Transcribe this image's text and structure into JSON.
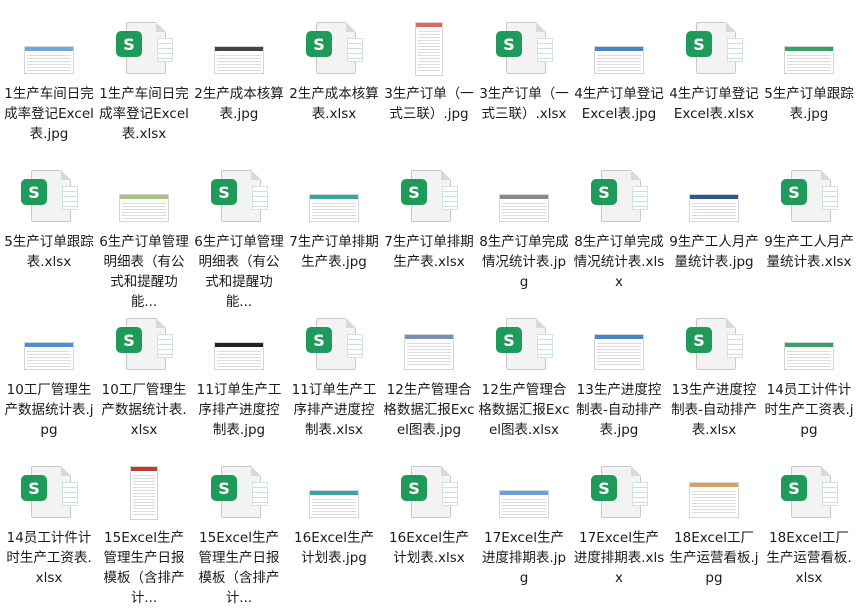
{
  "files": [
    {
      "name": "1生产车间日完成率登记Excel表.jpg",
      "kind": "jpg",
      "accent": "#6fa8dc",
      "shape": "wide"
    },
    {
      "name": "1生产车间日完成率登记Excel表.xlsx",
      "kind": "xlsx"
    },
    {
      "name": "2生产成本核算表.jpg",
      "kind": "jpg",
      "accent": "#444444",
      "shape": "wide"
    },
    {
      "name": "2生产成本核算表.xlsx",
      "kind": "xlsx"
    },
    {
      "name": "3生产订单（一式三联）.jpg",
      "kind": "jpg",
      "accent": "#e06666",
      "shape": "tall"
    },
    {
      "name": "3生产订单（一式三联）.xlsx",
      "kind": "xlsx"
    },
    {
      "name": "4生产订单登记Excel表.jpg",
      "kind": "jpg",
      "accent": "#4a86c5",
      "shape": "wide"
    },
    {
      "name": "4生产订单登记Excel表.xlsx",
      "kind": "xlsx"
    },
    {
      "name": "5生产订单跟踪表.jpg",
      "kind": "jpg",
      "accent": "#38a169",
      "shape": "wide"
    },
    {
      "name": "5生产订单跟踪表.xlsx",
      "kind": "xlsx"
    },
    {
      "name": "6生产订单管理明细表（有公式和提醒功能...",
      "kind": "jpg",
      "accent": "#a9c47f",
      "shape": "wide"
    },
    {
      "name": "6生产订单管理明细表（有公式和提醒功能...",
      "kind": "xlsx"
    },
    {
      "name": "7生产订单排期生产表.jpg",
      "kind": "jpg",
      "accent": "#3aa6a0",
      "shape": "wide"
    },
    {
      "name": "7生产订单排期生产表.xlsx",
      "kind": "xlsx"
    },
    {
      "name": "8生产订单完成情况统计表.jpg",
      "kind": "jpg",
      "accent": "#8a8a8a",
      "shape": "wide"
    },
    {
      "name": "8生产订单完成情况统计表.xlsx",
      "kind": "xlsx"
    },
    {
      "name": "9生产工人月产量统计表.jpg",
      "kind": "jpg",
      "accent": "#2f5597",
      "shape": "wide"
    },
    {
      "name": "9生产工人月产量统计表.xlsx",
      "kind": "xlsx"
    },
    {
      "name": "10工厂管理生产数据统计表.jpg",
      "kind": "jpg",
      "accent": "#4a90d9",
      "shape": "wide"
    },
    {
      "name": "10工厂管理生产数据统计表.xlsx",
      "kind": "xlsx"
    },
    {
      "name": "11订单生产工序排产进度控制表.jpg",
      "kind": "jpg",
      "accent": "#222222",
      "shape": "wide"
    },
    {
      "name": "11订单生产工序排产进度控制表.xlsx",
      "kind": "xlsx"
    },
    {
      "name": "12生产管理合格数据汇报Excel图表.jpg",
      "kind": "jpg",
      "accent": "#7a8fb0",
      "shape": "mid"
    },
    {
      "name": "12生产管理合格数据汇报Excel图表.xlsx",
      "kind": "xlsx"
    },
    {
      "name": "13生产进度控制表-自动排产表.jpg",
      "kind": "jpg",
      "accent": "#4a86c5",
      "shape": "mid"
    },
    {
      "name": "13生产进度控制表-自动排产表.xlsx",
      "kind": "xlsx"
    },
    {
      "name": "14员工计件计时生产工资表.jpg",
      "kind": "jpg",
      "accent": "#38a169",
      "shape": "wide"
    },
    {
      "name": "14员工计件计时生产工资表.xlsx",
      "kind": "xlsx"
    },
    {
      "name": "15Excel生产管理生产日报模板（含排产计...",
      "kind": "jpg",
      "accent": "#c0392b",
      "shape": "tall"
    },
    {
      "name": "15Excel生产管理生产日报模板（含排产计...",
      "kind": "xlsx"
    },
    {
      "name": "16Excel生产计划表.jpg",
      "kind": "jpg",
      "accent": "#3aa6a0",
      "shape": "wide"
    },
    {
      "name": "16Excel生产计划表.xlsx",
      "kind": "xlsx"
    },
    {
      "name": "17Excel生产进度排期表.jpg",
      "kind": "jpg",
      "accent": "#6f9fd8",
      "shape": "wide"
    },
    {
      "name": "17Excel生产进度排期表.xlsx",
      "kind": "xlsx"
    },
    {
      "name": "18Excel工厂生产运营看板.jpg",
      "kind": "jpg",
      "accent": "#d9a066",
      "shape": "mid"
    },
    {
      "name": "18Excel工厂生产运营看板.xlsx",
      "kind": "xlsx"
    }
  ],
  "xlsx_badge": "S"
}
